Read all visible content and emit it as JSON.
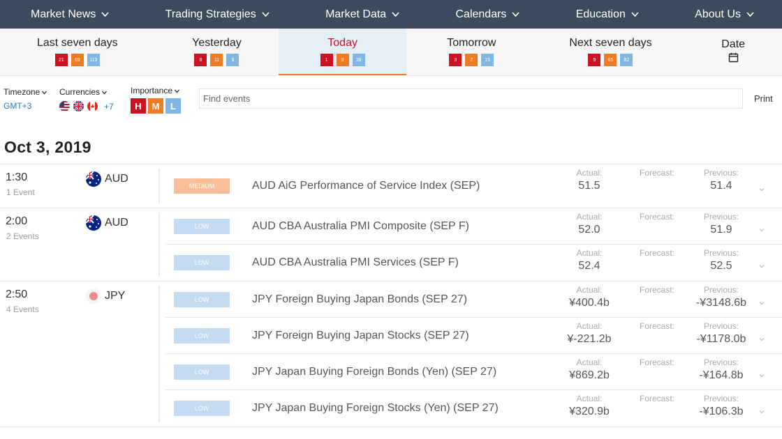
{
  "nav": [
    {
      "label": "Market News"
    },
    {
      "label": "Trading Strategies"
    },
    {
      "label": "Market Data"
    },
    {
      "label": "Calendars"
    },
    {
      "label": "Education"
    },
    {
      "label": "About Us"
    }
  ],
  "day_tabs": [
    {
      "label": "Last seven days",
      "high": "21",
      "medium": "69",
      "low": "113"
    },
    {
      "label": "Yesterday",
      "high": "8",
      "medium": "11",
      "low": "9"
    },
    {
      "label": "Today",
      "high": "1",
      "medium": "9",
      "low": "38"
    },
    {
      "label": "Tomorrow",
      "high": "3",
      "medium": "7",
      "low": "15"
    },
    {
      "label": "Next seven days",
      "high": "9",
      "medium": "65",
      "low": "82"
    }
  ],
  "date_tab": {
    "label": "Date",
    "icon": "calendar-icon"
  },
  "filters": {
    "timezone_label": "Timezone",
    "timezone_value": "GMT+3",
    "currencies_label": "Currencies",
    "currencies_more": "+7",
    "importance_label": "Importance",
    "importance_buttons": [
      "H",
      "M",
      "L"
    ],
    "search_placeholder": "Find events",
    "print_label": "Print"
  },
  "date_heading": "Oct 3, 2019",
  "labels": {
    "actual": "Actual:",
    "forecast": "Forecast:",
    "previous": "Previous:"
  },
  "groups": [
    {
      "time": "1:30",
      "count": "1 Event",
      "currency": "AUD",
      "flag": "australia-flag",
      "events": [
        {
          "importance": "MEDIUM",
          "title": "AUD AiG Performance of Service Index (SEP)",
          "actual": "51.5",
          "forecast": "",
          "previous": "51.4"
        }
      ]
    },
    {
      "time": "2:00",
      "count": "2 Events",
      "currency": "AUD",
      "flag": "australia-flag",
      "events": [
        {
          "importance": "LOW",
          "title": "AUD CBA Australia PMI Composite (SEP F)",
          "actual": "52.0",
          "forecast": "",
          "previous": "51.9"
        },
        {
          "importance": "LOW",
          "title": "AUD CBA Australia PMI Services (SEP F)",
          "actual": "52.4",
          "forecast": "",
          "previous": "52.5"
        }
      ]
    },
    {
      "time": "2:50",
      "count": "4 Events",
      "currency": "JPY",
      "flag": "japan-flag",
      "events": [
        {
          "importance": "LOW",
          "title": "JPY Foreign Buying Japan Bonds (SEP 27)",
          "actual": "¥400.4b",
          "forecast": "",
          "previous": "-¥3148.6b"
        },
        {
          "importance": "LOW",
          "title": "JPY Foreign Buying Japan Stocks (SEP 27)",
          "actual": "¥-221.2b",
          "forecast": "",
          "previous": "-¥1178.0b"
        },
        {
          "importance": "LOW",
          "title": "JPY Japan Buying Foreign Bonds (Yen) (SEP 27)",
          "actual": "¥869.2b",
          "forecast": "",
          "previous": "-¥164.8b"
        },
        {
          "importance": "LOW",
          "title": "JPY Japan Buying Foreign Stocks (Yen) (SEP 27)",
          "actual": "¥320.9b",
          "forecast": "",
          "previous": "-¥106.3b"
        }
      ]
    }
  ],
  "colors": {
    "nav_bg": "#3c4c5e",
    "high": "#cc1122",
    "medium": "#f07b25",
    "low": "#7fb6e3",
    "accent": "#2a7ab8"
  }
}
